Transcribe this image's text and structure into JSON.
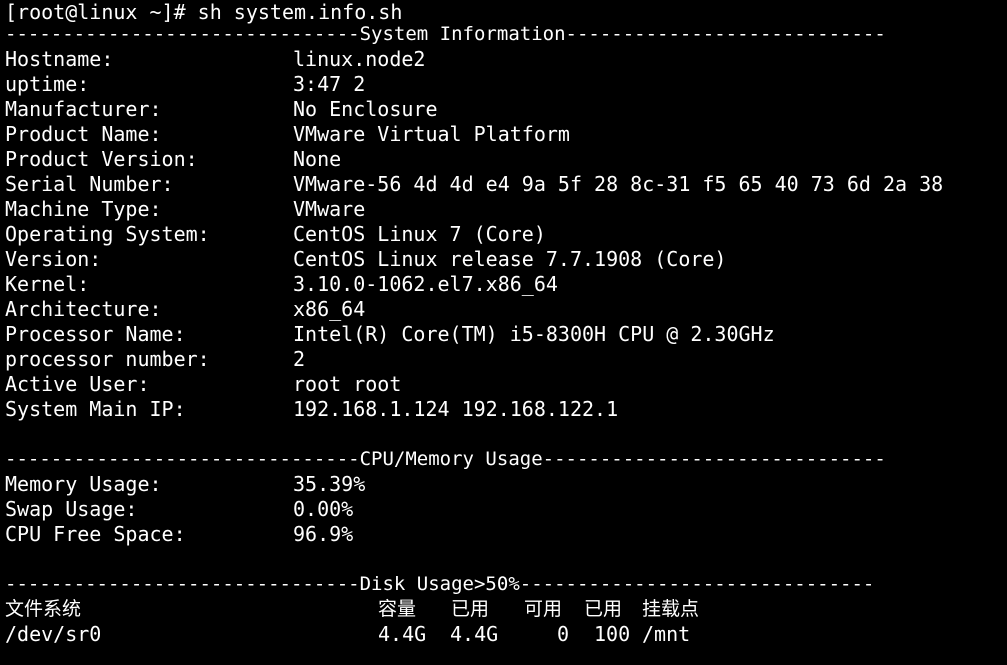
{
  "terminal": {
    "prompt": "[root@linux ~]# sh system.info.sh",
    "sections": {
      "system_header": "-------------------------------System Information----------------------------",
      "cpu_header": "-------------------------------CPU/Memory Usage------------------------------",
      "disk_header": "-------------------------------Disk Usage>50%-------------------------------"
    },
    "system_info": [
      {
        "label": "Hostname:",
        "value": "linux.node2"
      },
      {
        "label": "uptime:",
        "value": "3:47 2"
      },
      {
        "label": "Manufacturer:",
        "value": "No Enclosure"
      },
      {
        "label": "Product Name:",
        "value": "VMware Virtual Platform"
      },
      {
        "label": "Product Version:",
        "value": "None"
      },
      {
        "label": "Serial Number:",
        "value": "VMware-56 4d 4d e4 9a 5f 28 8c-31 f5 65 40 73 6d 2a 38"
      },
      {
        "label": "Machine Type:",
        "value": "VMware"
      },
      {
        "label": "Operating System:",
        "value": "CentOS Linux 7 (Core)"
      },
      {
        "label": "Version:",
        "value": "CentOS Linux release 7.7.1908 (Core)"
      },
      {
        "label": "Kernel:",
        "value": "3.10.0-1062.el7.x86_64"
      },
      {
        "label": "Architecture:",
        "value": "x86_64"
      },
      {
        "label": "Processor Name:",
        "value": "Intel(R) Core(TM) i5-8300H CPU @ 2.30GHz"
      },
      {
        "label": "processor number:",
        "value": "2"
      },
      {
        "label": "Active User:",
        "value": "root root"
      },
      {
        "label": "System Main IP:",
        "value": "192.168.1.124 192.168.122.1"
      }
    ],
    "usage": [
      {
        "label": "Memory Usage:",
        "value": "35.39%"
      },
      {
        "label": "Swap Usage:",
        "value": "0.00%"
      },
      {
        "label": "CPU Free Space:",
        "value": "96.9%"
      }
    ],
    "disk": {
      "headers": {
        "filesystem": "文件系统",
        "size": "容量",
        "used": "已用",
        "avail": "可用",
        "use_pct": "已用",
        "mount": "挂载点"
      },
      "rows": [
        {
          "filesystem": "/dev/sr0",
          "size": "4.4G",
          "used": "4.4G",
          "avail": "0",
          "use_pct": "100",
          "mount": "/mnt"
        }
      ]
    }
  }
}
